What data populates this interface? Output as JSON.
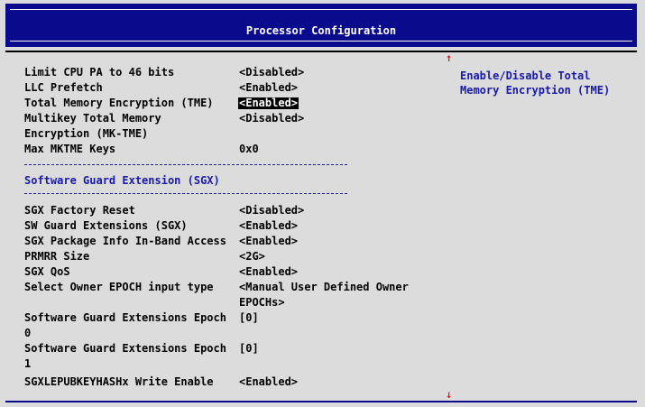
{
  "header": {
    "title": "Processor Configuration"
  },
  "help": {
    "text": "Enable/Disable Total Memory Encryption (TME)"
  },
  "scroll": {
    "up_arrow": "↑",
    "down_arrow": "↓"
  },
  "settings_top": [
    {
      "label": "Limit CPU PA to 46 bits",
      "value": "<Disabled>"
    },
    {
      "label": "LLC Prefetch",
      "value": "<Enabled>"
    },
    {
      "label": "Total Memory Encryption (TME)",
      "value": "<Enabled>"
    },
    {
      "label": "Multikey Total Memory",
      "value": "<Disabled>"
    },
    {
      "label": "Encryption (MK-TME)",
      "value": ""
    },
    {
      "label": "Max MKTME Keys",
      "value": "0x0"
    }
  ],
  "section": {
    "title": "Software Guard Extension (SGX)"
  },
  "settings_sgx": [
    {
      "label": "SGX Factory Reset",
      "value": "<Disabled>"
    },
    {
      "label": "SW Guard Extensions (SGX)",
      "value": "<Enabled>"
    },
    {
      "label": "SGX Package Info In-Band Access",
      "value": "<Enabled>"
    },
    {
      "label": "PRMRR Size",
      "value": "<2G>"
    },
    {
      "label": "SGX QoS",
      "value": "<Enabled>"
    },
    {
      "label": "Select Owner EPOCH input type",
      "value": "<Manual User Defined Owner"
    },
    {
      "label": "",
      "value": "EPOCHs>"
    },
    {
      "label": "Software Guard Extensions Epoch",
      "value": "[0]"
    },
    {
      "label": "0",
      "value": ""
    },
    {
      "label": "Software Guard Extensions Epoch",
      "value": "[0]"
    },
    {
      "label": "1",
      "value": ""
    },
    {
      "label": "SGXLEPUBKEYHASHx Write Enable",
      "value": "<Enabled>"
    }
  ],
  "colors": {
    "title_bg": "#0a0a8c",
    "body_bg": "#dcdcdc",
    "accent_blue": "#1a1aa8",
    "arrow_red": "#e21b1b"
  }
}
